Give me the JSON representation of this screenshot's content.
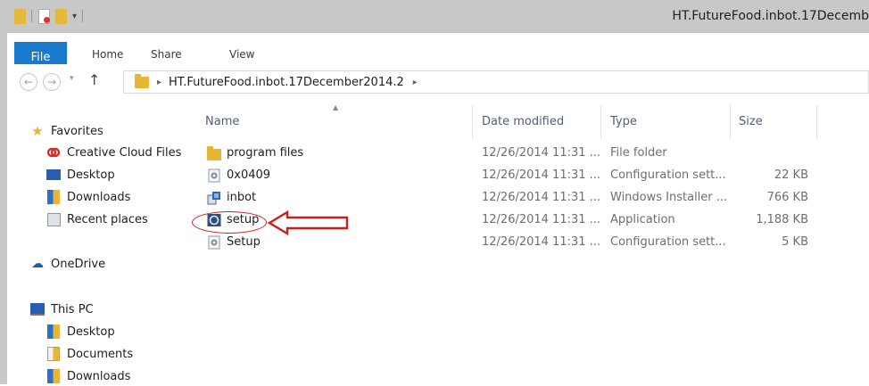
{
  "window": {
    "title": "HT.FutureFood.inbot.17Decemb"
  },
  "ribbon": {
    "tabs": [
      "File",
      "Home",
      "Share",
      "View"
    ]
  },
  "address": {
    "path": "HT.FutureFood.inbot.17December2014.2"
  },
  "nav": {
    "favorites": "Favorites",
    "creative_cloud": "Creative Cloud Files",
    "desktop": "Desktop",
    "downloads": "Downloads",
    "recent": "Recent places",
    "onedrive": "OneDrive",
    "this_pc": "This PC",
    "pc_desktop": "Desktop",
    "pc_documents": "Documents",
    "pc_downloads": "Downloads"
  },
  "columns": [
    "Name",
    "Date modified",
    "Type",
    "Size"
  ],
  "files": [
    {
      "name": "program files",
      "date": "12/26/2014 11:31 ...",
      "type": "File folder",
      "size": "",
      "icon": "folder"
    },
    {
      "name": "0x0409",
      "date": "12/26/2014 11:31 ...",
      "type": "Configuration sett...",
      "size": "22 KB",
      "icon": "config"
    },
    {
      "name": "inbot",
      "date": "12/26/2014 11:31 ...",
      "type": "Windows Installer ...",
      "size": "766 KB",
      "icon": "installer"
    },
    {
      "name": "setup",
      "date": "12/26/2014 11:31 ...",
      "type": "Application",
      "size": "1,188 KB",
      "icon": "application"
    },
    {
      "name": "Setup",
      "date": "12/26/2014 11:31 ...",
      "type": "Configuration sett...",
      "size": "5 KB",
      "icon": "config"
    }
  ],
  "colors": {
    "file_tab": "#1979ca",
    "annotation_red": "#c71f1f",
    "header_text": "#4d5f79",
    "folder": "#e8b634"
  }
}
